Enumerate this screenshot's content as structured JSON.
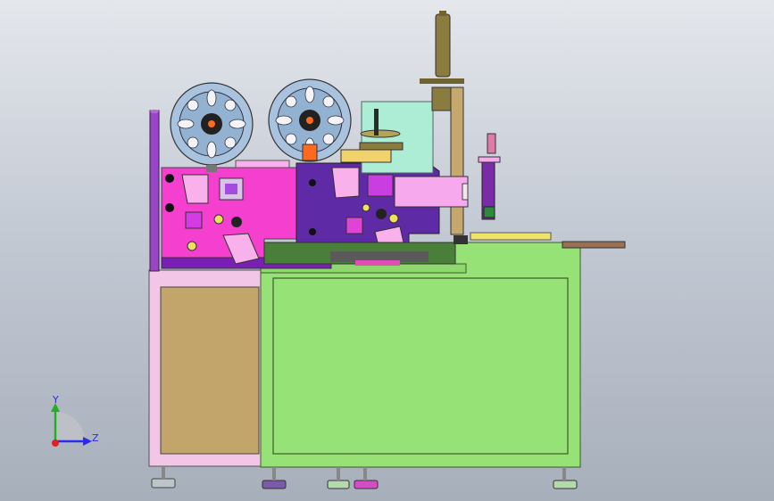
{
  "viewport": {
    "background_top": "#e4e7ec",
    "background_bottom": "#a7afbb"
  },
  "triad": {
    "y_label": "Y",
    "z_label": "Z",
    "y_axis_color": "#22b022",
    "z_axis_color": "#2a2af0",
    "origin_color": "#e02020"
  },
  "model_colors": {
    "frame_pink": "#f2c6e6",
    "door_tan": "#c2a56a",
    "cabinet_green": "#96e276",
    "plate_magenta": "#f53fcf",
    "plate_purple": "#5f2aa5",
    "reel_blue": "#a9c3df",
    "column_olive": "#8a7b3e",
    "mint_box": "#aeedd5",
    "arm_pink": "#f6a9ec",
    "post_purple": "#9a45c5"
  }
}
